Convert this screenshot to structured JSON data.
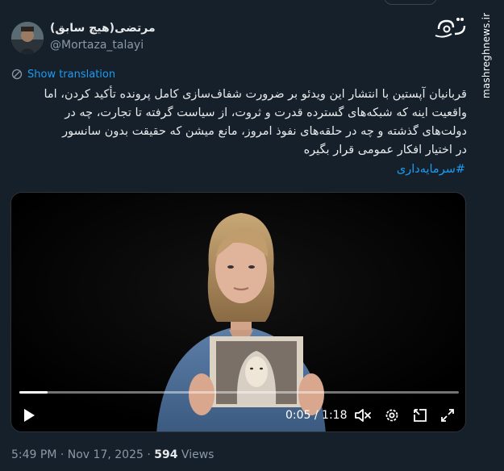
{
  "author": {
    "name": "مرتضی(هیچ سابق)",
    "handle": "@Mortaza_talayi"
  },
  "translation": {
    "label": "Show translation"
  },
  "tweet": {
    "text": "قربانیان آپستین با انتشار این ویدئو بر ضرورت شفاف‌سازی کامل پرونده تأکید کردن، اما\nواقعیت اینه که شبکه‌های گسترده قدرت و ثروت، از سیاست گرفته تا تجارت، چه در\nدولت‌های گذشته و چه در حلقه‌های نفوذ امروز، مانع میشن که حقیقت بدون سانسور\nدر اختیار افکار عمومی قرار بگیره",
    "hashtag": "#سرمایه‌داری"
  },
  "video": {
    "time_display": "0:05 / 1:18",
    "progress": 0.064
  },
  "meta": {
    "timestamp": "5:49 PM · Nov 17, 2025 ·",
    "views_count": "594",
    "views_label": "Views"
  },
  "watermark": {
    "site": "mashreghnews.ir",
    "logo_text": "مشرق"
  },
  "colors": {
    "background": "#15202b",
    "accent": "#1d9bf0",
    "muted_text": "#8b98a5"
  },
  "icons": [
    "translate-icon",
    "play-icon",
    "volume-muted-icon",
    "settings-icon",
    "pip-icon",
    "fullscreen-icon"
  ]
}
